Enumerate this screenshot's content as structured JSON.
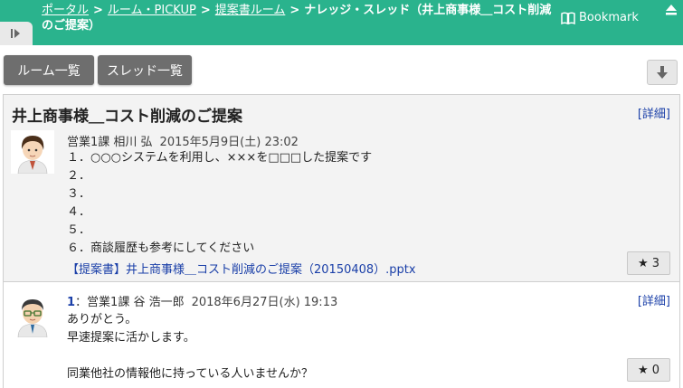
{
  "header": {
    "breadcrumb": [
      {
        "label": "ポータル",
        "link": true
      },
      {
        "label": "ルーム・PICKUP",
        "link": true
      },
      {
        "label": "提案書ルーム",
        "link": true
      },
      {
        "label": "ナレッジ・スレッド（井上商事様＿コスト削減のご提案）",
        "link": false
      }
    ],
    "separator": ">",
    "bookmark_label": "Bookmark"
  },
  "toolbar": {
    "room_list_label": "ルーム一覧",
    "thread_list_label": "スレッド一覧"
  },
  "thread": {
    "title": "井上商事様＿コスト削減のご提案",
    "detail_label": "[詳細]",
    "posts": [
      {
        "author": "営業1課 相川 弘",
        "date": "2015年5月9日(土) 23:02",
        "lines": [
          "１．○○○システムを利用し、×××を□□□した提案です",
          "２．",
          "３．",
          "４．",
          "５．",
          "６．商談履歴も参考にしてください"
        ],
        "attachment": "【提案書】井上商事様＿コスト削減のご提案（20150408）.pptx",
        "stars": "3"
      },
      {
        "number": "1",
        "author": "：営業1課 谷 浩一郎",
        "date": "2018年6月27日(水) 19:13",
        "lines": [
          "ありがとう。",
          "早速提案に活かします。",
          "",
          "同業他社の情報他に持っている人いませんか？"
        ],
        "stars": "0"
      }
    ]
  },
  "colors": {
    "header_bg": "#2ab38d",
    "button_bg": "#6e6e6e",
    "link": "#1a3fa8"
  }
}
